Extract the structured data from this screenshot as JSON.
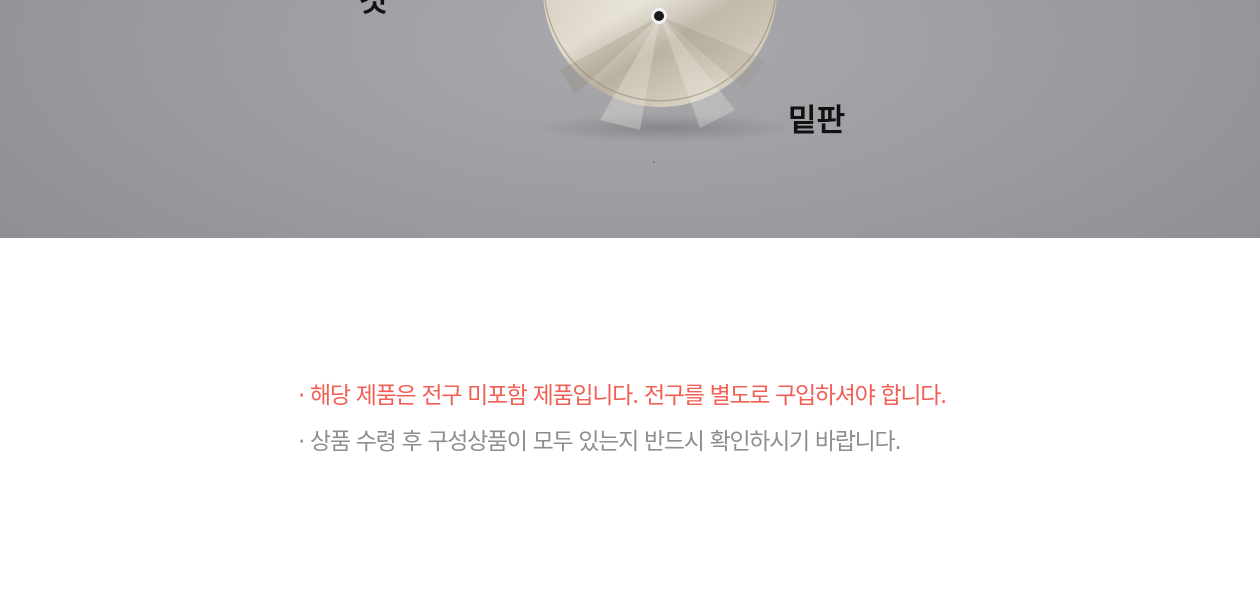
{
  "photo": {
    "label_top": "것",
    "label_base": "밑판"
  },
  "notes": {
    "warning": "· 해당 제품은 전구 미포함 제품입니다. 전구를 별도로 구입하셔야 합니다.",
    "info": "· 상품 수령 후 구성상품이 모두 있는지 반드시 확인하시기 바랍니다."
  },
  "colors": {
    "warning_text": "#f25f55",
    "info_text": "#8e8e8e",
    "photo_background": "#9c9ca1",
    "base_metal": "#d2cabb"
  }
}
